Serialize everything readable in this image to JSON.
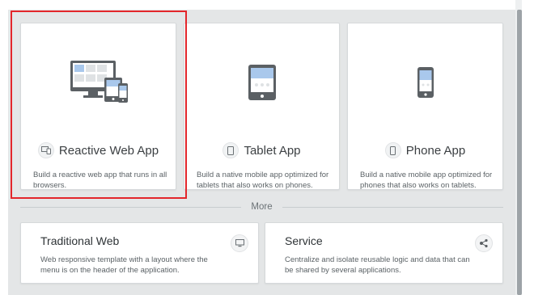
{
  "app_types": [
    {
      "title": "Reactive Web App",
      "description": "Build a reactive web app that runs in all browsers.",
      "icon": "responsive-devices-icon",
      "selected": true
    },
    {
      "title": "Tablet App",
      "description": "Build a native mobile app optimized for tablets that also works on phones.",
      "icon": "tablet-icon",
      "selected": false
    },
    {
      "title": "Phone App",
      "description": "Build a native mobile app optimized for phones that also works on tablets.",
      "icon": "phone-icon",
      "selected": false
    }
  ],
  "more_label": "More",
  "more_types": [
    {
      "title": "Traditional Web",
      "description": "Web responsive template with a layout where the menu is on the header of the application.",
      "icon": "monitor-icon"
    },
    {
      "title": "Service",
      "description": "Centralize and isolate reusable logic and data that can be shared by several applications.",
      "icon": "service-network-icon"
    }
  ],
  "colors": {
    "selection": "#e3262b",
    "accent": "#a9c8ec",
    "device": "#5b6064"
  }
}
